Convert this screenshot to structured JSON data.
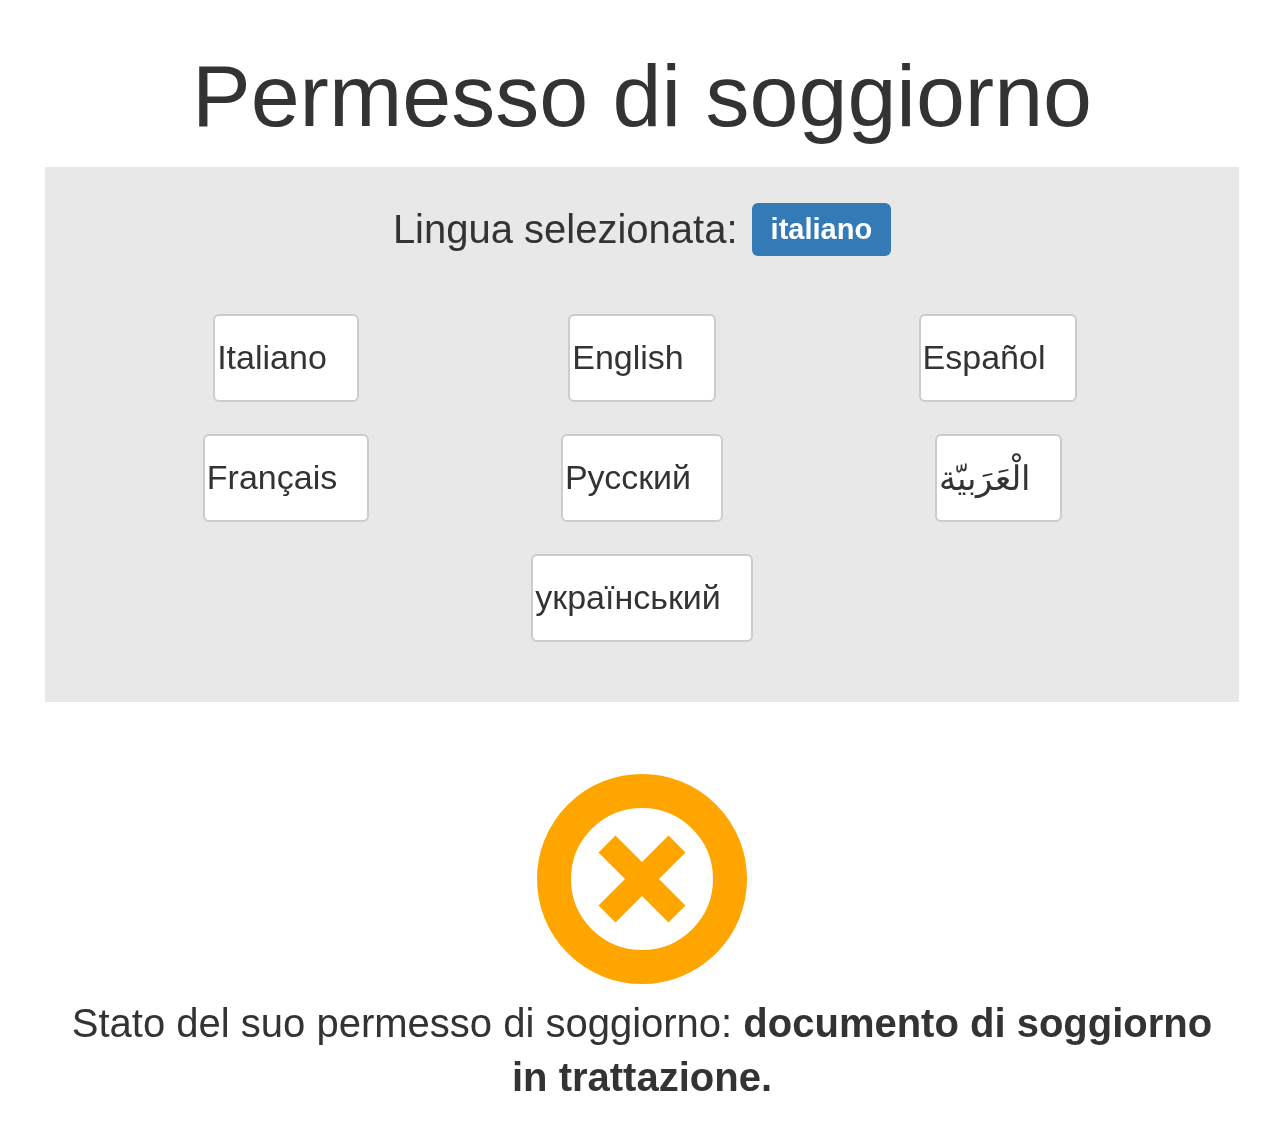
{
  "title": "Permesso di soggiorno",
  "language_panel": {
    "label": "Lingua selezionata:",
    "selected_badge": "italiano",
    "languages": [
      {
        "label": "Italiano"
      },
      {
        "label": "English"
      },
      {
        "label": "Español"
      },
      {
        "label": "Français"
      },
      {
        "label": "Русский"
      },
      {
        "label": "الْعَرَبيّة"
      },
      {
        "label": "український"
      }
    ]
  },
  "status": {
    "kind": "error",
    "text": "Stato del suo permesso di soggiorno: **documento di soggiorno in trattazione.**"
  }
}
